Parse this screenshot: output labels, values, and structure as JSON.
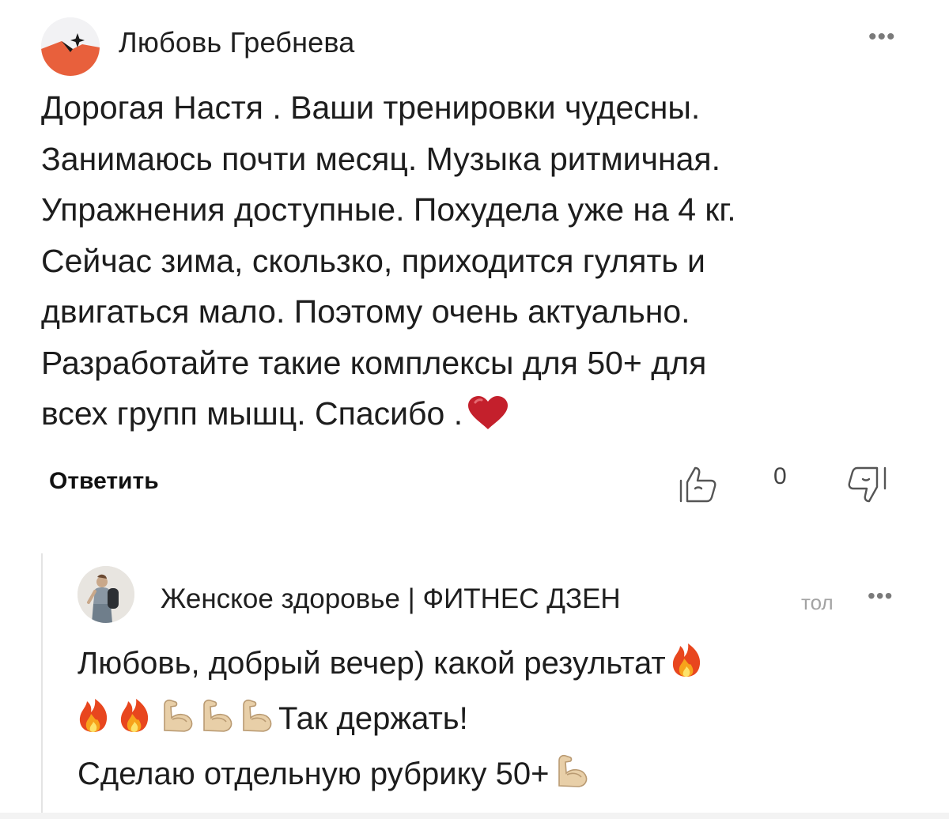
{
  "comment": {
    "author": "Любовь Гребнева",
    "more_label": "•••",
    "lines": [
      "Дорогая Настя . Ваши тренировки чудесны.",
      "Занимаюсь почти месяц. Музыка ритмичная.",
      "Упражнения доступные. Похудела уже на 4 кг.",
      "Сейчас зима, скользко, приходится гулять и",
      "двигаться мало. Поэтому очень актуально.",
      "Разработайте такие комплексы для 50+ для",
      "всех групп мышц. Спасибо ."
    ],
    "reply_label": "Ответить",
    "like_count": "0",
    "icons": {
      "like": "thumbs-up-icon",
      "dislike": "thumbs-down-icon",
      "heart": "heart-emoji",
      "more": "more-dots-icon"
    }
  },
  "reply": {
    "author": "Женское здоровье | ФИТНЕС ДЗЕН",
    "time": "тол",
    "more_label": "•••",
    "line1": "Любовь, добрый вечер) какой результат",
    "line2_text": "Так держать!",
    "line3": "Сделаю отдельную рубрику 50+",
    "icons": {
      "fire": "fire-emoji",
      "bicep": "flexed-biceps-emoji"
    }
  },
  "colors": {
    "heart": "#c4202c",
    "avatar_orange": "#e8603c",
    "muted": "#a3a3a3"
  }
}
